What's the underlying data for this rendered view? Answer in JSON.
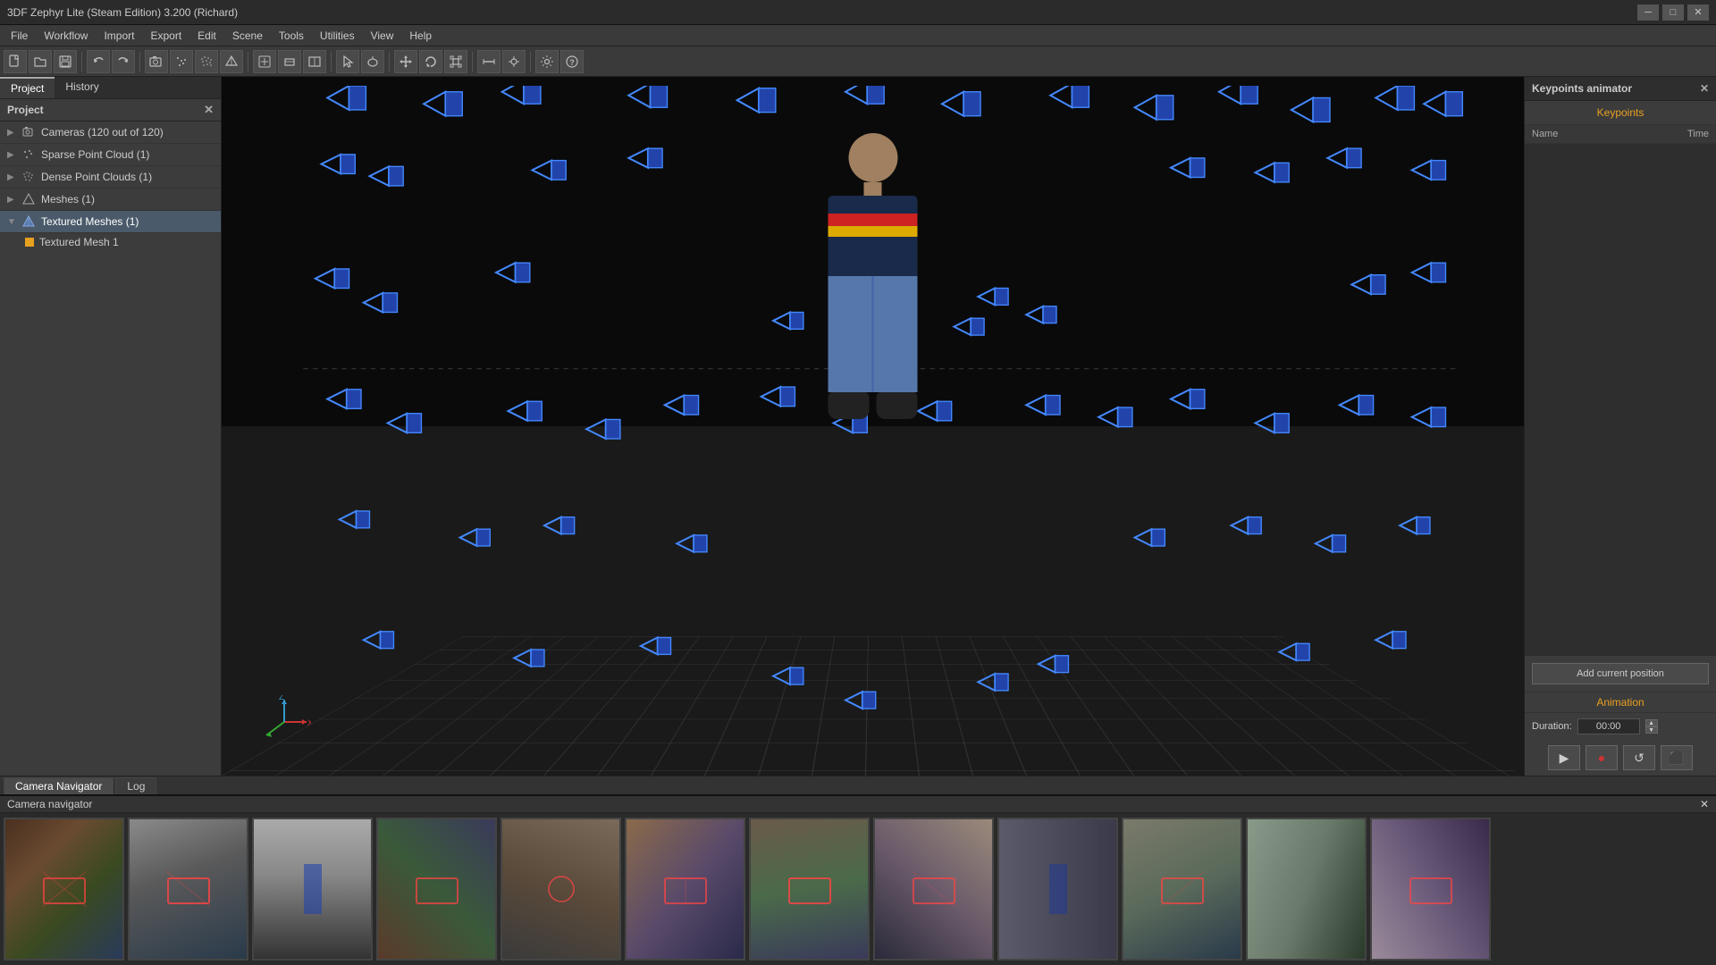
{
  "window": {
    "title": "3DF Zephyr Lite (Steam Edition) 3.200 (Richard)"
  },
  "menu": {
    "items": [
      "File",
      "Workflow",
      "Import",
      "Export",
      "Edit",
      "Scene",
      "Tools",
      "Utilities",
      "View",
      "Help"
    ]
  },
  "panel": {
    "tabs": [
      "Project",
      "History"
    ],
    "title": "Project",
    "tree": [
      {
        "label": "Cameras (120 out of 120)",
        "icon": "camera",
        "active": false
      },
      {
        "label": "Sparse Point Cloud (1)",
        "icon": "points",
        "active": false
      },
      {
        "label": "Dense Point Clouds (1)",
        "icon": "dense",
        "active": false
      },
      {
        "label": "Meshes (1)",
        "icon": "mesh",
        "active": false
      },
      {
        "label": "Textured Meshes (1)",
        "icon": "textured",
        "active": true
      }
    ],
    "sub_items": [
      {
        "label": "Textured Mesh 1"
      }
    ]
  },
  "right_panel": {
    "title": "Keypoints animator",
    "close_label": "×",
    "keypoints_title": "Keypoints",
    "table_headers": [
      "Name",
      "Time"
    ],
    "add_position_label": "Add current position",
    "animation_title": "Animation",
    "duration_label": "Duration:",
    "duration_value": "00:00",
    "controls": [
      "▶",
      "●",
      "↺",
      "⬛"
    ]
  },
  "bottom_tabs": [
    "Camera Navigator",
    "Log"
  ],
  "cam_navigator": {
    "title": "Camera navigator",
    "close_label": "×"
  },
  "status_bar": {
    "text": ""
  },
  "toolbar": {
    "buttons": [
      "⊙",
      "⊙",
      "◎",
      "◯",
      "▭",
      "◧",
      "⊞",
      "◉",
      "⊕",
      "◑",
      "◔",
      "☰",
      "☷",
      "▤",
      "▣",
      "▩",
      "⊛",
      "⊗",
      "⊘",
      "⊙",
      "⊚",
      "◩",
      "◪",
      "◫",
      "◬",
      "◭",
      "◮",
      "◯",
      "◰",
      "◱",
      "◲",
      "◳",
      "◴",
      "◵",
      "◶",
      "◷",
      "◸",
      "◹",
      "◺",
      "◻"
    ]
  },
  "axis": {
    "x_label": "X",
    "z_label": "Z"
  }
}
